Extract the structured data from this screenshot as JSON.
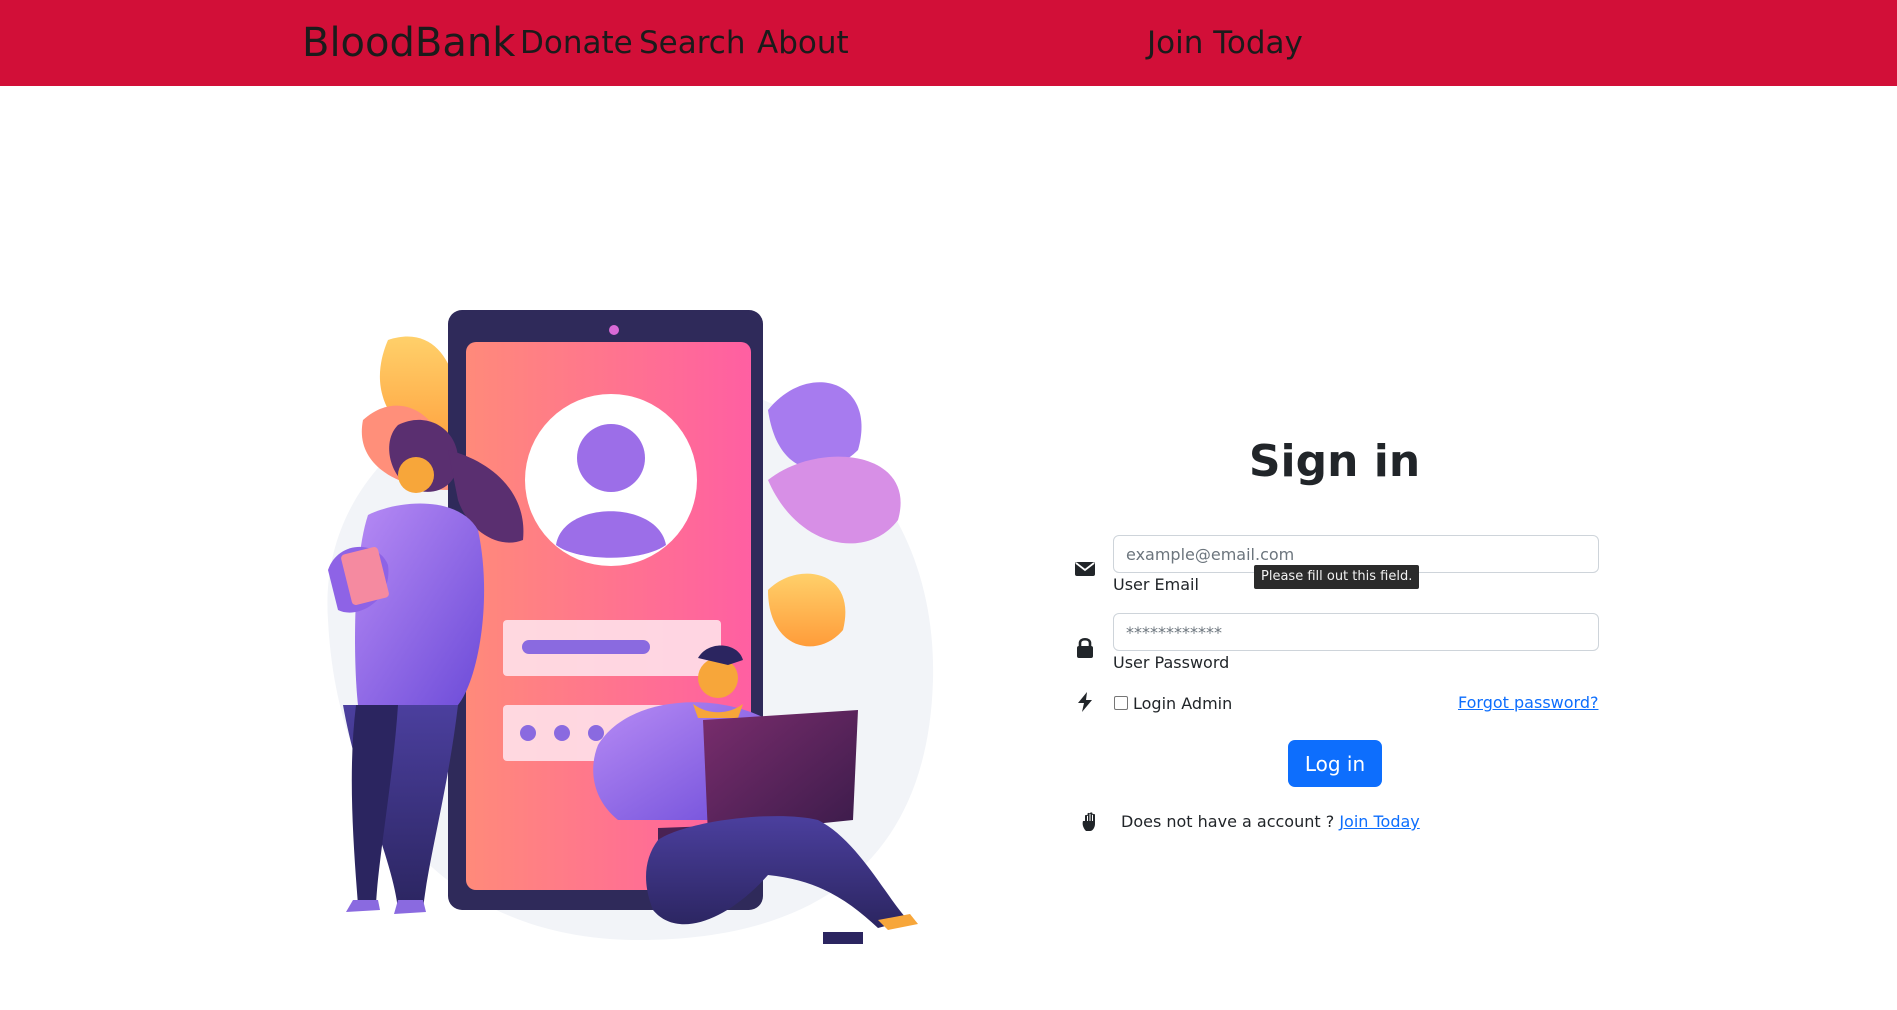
{
  "navbar": {
    "brand": "BloodBank",
    "links": [
      "Donate",
      "Search",
      "About"
    ],
    "join": "Join Today",
    "bg_color": "#d20f38"
  },
  "hero": {
    "icon": "login-illustration"
  },
  "signin": {
    "title": "Sign in",
    "email": {
      "icon": "envelope-icon",
      "placeholder": "example@email.com",
      "label": "User Email"
    },
    "tooltip": "Please fill out this field.",
    "password": {
      "icon": "lock-icon",
      "placeholder": "************",
      "label": "User Password"
    },
    "admin": {
      "icon": "bolt-icon",
      "label": "Login Admin",
      "checked": false
    },
    "forgot": "Forgot password?",
    "login_button": "Log in",
    "signup": {
      "icon": "hand-icon",
      "text": "Does not have a account ?",
      "link": "Join Today"
    },
    "accent_color": "#0d6efd"
  }
}
